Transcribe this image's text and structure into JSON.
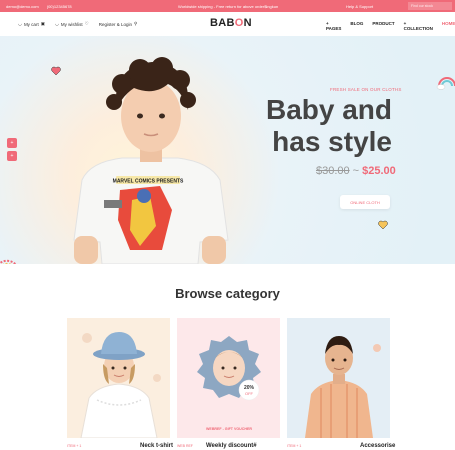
{
  "topbar": {
    "email": "demo@demo.com",
    "phone": "(00)12345678",
    "promo": "Worldwide shipping - Free return for above order$ingkun",
    "help": "Help & Support",
    "search_placeholder": "Find our stock"
  },
  "header": {
    "my_cart": "My cart",
    "my_wishlist": "My wishlist",
    "account": "Register & Login",
    "logo_prefix": "BAB",
    "logo_o": "O",
    "logo_suffix": "N",
    "nav": [
      "PAGES",
      "BLOG",
      "PRODUCT",
      "COLLECTION",
      "HOME"
    ]
  },
  "hero": {
    "subtitle": "FRESH SALE ON OUR CLOTHS",
    "title_line1": "Baby and",
    "title_line2": "has style",
    "old_price": "$30.00",
    "separator": "~",
    "new_price": "$25.00",
    "button": "ONLINE CLOTH",
    "shirt_text": "MARVEL COMICS PRESENTS"
  },
  "browse": {
    "title": "Browse category",
    "cards": [
      {
        "tag": "ITEM + 1",
        "label": "Neck t-shirt"
      },
      {
        "tag": "WEB REF",
        "label": "Weekly discount#",
        "badge_pct": "20%",
        "badge_off": "OFF",
        "voucher": "WEBREF - GIFT VOUCHER"
      },
      {
        "tag": "ITEM + 1",
        "label": "Accessorise"
      }
    ]
  },
  "colors": {
    "accent": "#f06a78",
    "text": "#222222"
  }
}
